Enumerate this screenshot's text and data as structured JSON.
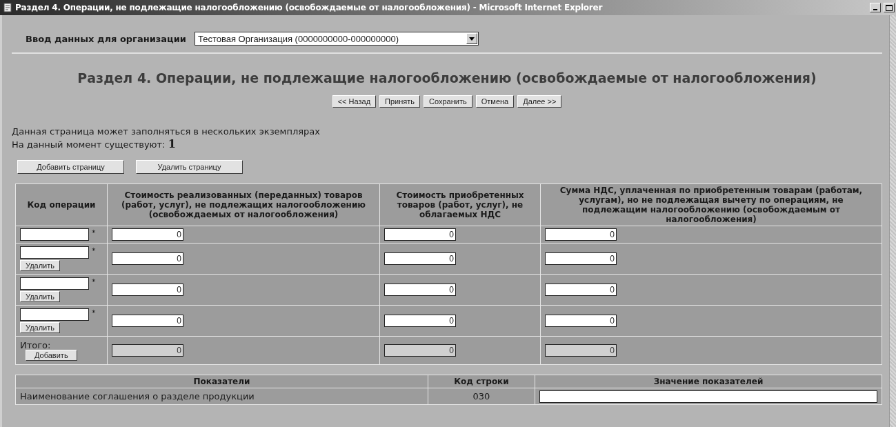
{
  "window": {
    "title": "Раздел 4. Операции, не подлежащие налогообложению (освобождаемые от налогообложения) - Microsoft Internet Explorer"
  },
  "organization": {
    "label": "Ввод данных для организации",
    "value": "Тестовая Организация (0000000000-000000000)"
  },
  "heading": "Раздел 4. Операции, не подлежащие налогообложению (освобождаемые от налогообложения)",
  "nav_buttons": [
    "<< Назад",
    "Принять",
    "Сохранить",
    "Отмена",
    "Далее >>"
  ],
  "info": {
    "line": "Данная страница может заполняться в нескольких экземплярах",
    "count_label": "На данный момент существуют:",
    "count": "1"
  },
  "page_buttons": [
    "Добавить страницу",
    "Удалить страницу"
  ],
  "table": {
    "columns": [
      "Код операции",
      "Стоимость реализованных (переданных) товаров (работ, услуг), не подлежащих налогообложению (освобождаемых от налогообложения)",
      "Стоимость приобретенных товаров (работ, услуг), не облагаемых НДС",
      "Сумма НДС, уплаченная по приобретенным товарам (работам, услугам), но не подлежащая вычету по операциям, не подлежащим налогообложению (освобождаемым от налогообложения)"
    ],
    "rows": [
      {
        "required_mark": "*",
        "values": [
          "0",
          "0",
          "0"
        ]
      },
      {
        "required_mark": "*",
        "delete_button": "Удалить",
        "values": [
          "0",
          "0",
          "0"
        ]
      },
      {
        "required_mark": "*",
        "delete_button": "Удалить",
        "values": [
          "0",
          "0",
          "0"
        ]
      },
      {
        "required_mark": "*",
        "delete_button": "Удалить",
        "values": [
          "0",
          "0",
          "0"
        ]
      }
    ],
    "total": {
      "label": "Итого:",
      "add_button": "Добавить",
      "values": [
        "0",
        "0",
        "0"
      ],
      "disabled": true
    }
  },
  "indicators": {
    "columns": [
      "Показатели",
      "Код строки",
      "Значение показателей"
    ],
    "rows": [
      {
        "name": "Наименование соглашения о разделе продукции",
        "code": "030"
      }
    ]
  }
}
